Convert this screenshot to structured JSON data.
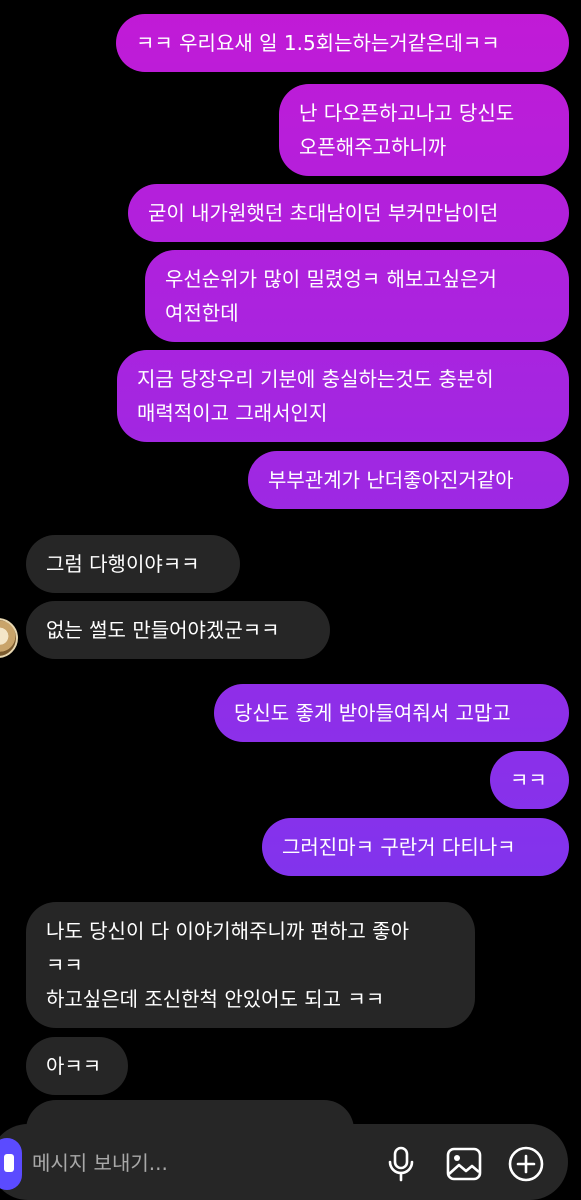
{
  "colors": {
    "background": "#000000",
    "received_bubble": "#262626",
    "sent_gradient_top": "#c21ad6",
    "sent_gradient_bottom": "#6a3df5",
    "composer_background": "#262626",
    "placeholder": "#a8a8a8"
  },
  "messages": [
    {
      "direction": "sent",
      "lines": [
        "ㅋㅋ 우리요새 일 1.5회는하는거같은데ㅋㅋ"
      ]
    },
    {
      "direction": "sent",
      "lines": [
        "난 다오픈하고나고 당신도",
        "오픈해주고하니까"
      ]
    },
    {
      "direction": "sent",
      "lines": [
        "굳이 내가원햇던 초대남이던 부커만남이던"
      ]
    },
    {
      "direction": "sent",
      "lines": [
        "우선순위가 많이 밀렸엉ㅋ 해보고싶은거",
        "여전한데"
      ]
    },
    {
      "direction": "sent",
      "lines": [
        "지금 당장우리 기분에 충실하는것도 충분히",
        "매력적이고 그래서인지"
      ]
    },
    {
      "direction": "sent",
      "lines": [
        "부부관계가 난더좋아진거같아"
      ]
    },
    {
      "direction": "received",
      "lines": [
        "그럼 다행이야ㅋㅋ"
      ]
    },
    {
      "direction": "received",
      "lines": [
        "없는 썰도 만들어야겠군ㅋㅋ"
      ]
    },
    {
      "direction": "sent",
      "lines": [
        "당신도 좋게 받아들여줘서 고맙고"
      ]
    },
    {
      "direction": "sent",
      "lines": [
        "ㅋㅋ"
      ]
    },
    {
      "direction": "sent",
      "lines": [
        "그러진마ㅋ 구란거 다티나ㅋ"
      ]
    },
    {
      "direction": "received",
      "lines": [
        "나도 당신이 다 이야기해주니까 편하고 좋아",
        "ㅋㅋ",
        "하고싶은데 조신한척 안있어도 되고 ㅋㅋ"
      ]
    },
    {
      "direction": "received",
      "lines": [
        "아ㅋㅋ"
      ]
    }
  ],
  "composer": {
    "placeholder": "메시지 보내기...",
    "buttons": [
      "microphone-icon",
      "image-icon",
      "add-icon"
    ],
    "left_button_icon": "camera-icon"
  }
}
